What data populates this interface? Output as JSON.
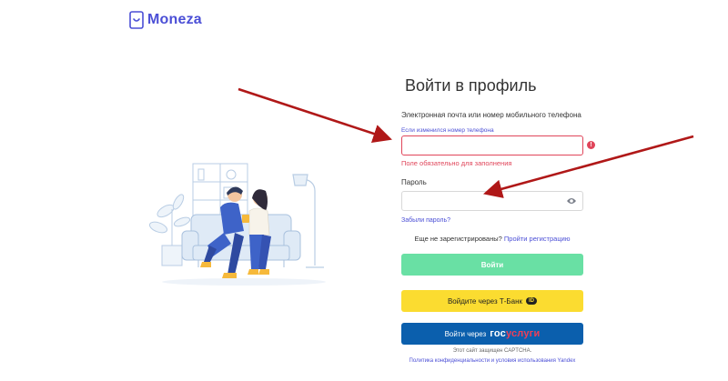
{
  "brand": {
    "name": "Moneza",
    "color": "#4b4fd6"
  },
  "form": {
    "title": "Войти в профиль",
    "email_label": "Электронная почта или номер мобильного телефона",
    "phone_changed_hint": "Если изменился номер телефона",
    "email_value": "",
    "email_error": "Поле обязательно для заполнения",
    "password_label": "Пароль",
    "password_value": "",
    "forgot_link": "Забыли пароль?",
    "not_registered": "Еще не зарегистрированы?",
    "register_link": "Пройти регистрацию",
    "login_button": "Войти",
    "tbank_button": "Войдите через Т-Банк",
    "tbank_badge": "ID",
    "gosuslugi_prefix": "Войти через",
    "gosuslugi_logo_a": "гос",
    "gosuslugi_logo_b": "услуги",
    "captcha_note": "Этот сайт защищен CAPTCHA.",
    "policy_link": "Политика конфиденциальности и условия использования Yandex"
  },
  "icons": {
    "logo": "moneza-logo-icon",
    "error": "error-icon",
    "eye": "eye-icon"
  },
  "colors": {
    "error": "#e0455a",
    "login_button": "#69e0a4",
    "tbank_button": "#fbdc30",
    "gosuslugi_button": "#0b5fad",
    "annotation_arrow": "#b01818"
  }
}
